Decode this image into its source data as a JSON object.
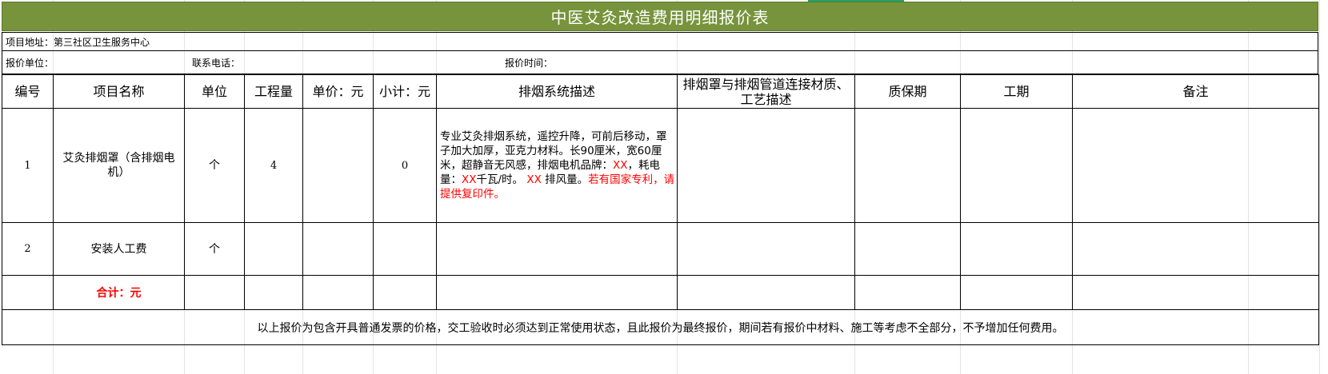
{
  "title": "中医艾灸改造费用明细报价表",
  "info": {
    "address_label": "项目地址：",
    "address_value": "第三社区卫生服务中心",
    "quote_unit_label": "报价单位：",
    "contact_label": "联系电话：",
    "quote_time_label": "报价时间："
  },
  "table": {
    "headers": {
      "no": "编号",
      "name": "项目名称",
      "unit": "单位",
      "qty": "工程量",
      "price": "单价：元",
      "subtotal": "小计：元",
      "system_desc": "排烟系统描述",
      "connect_desc": "排烟罩与排烟管道连接材质、工艺描述",
      "warranty": "质保期",
      "period": "工期",
      "remarks": "备注"
    },
    "rows": [
      {
        "no": "1",
        "name": "艾灸排烟罩（含排烟电机）",
        "unit": "个",
        "qty": "4",
        "price": "",
        "subtotal": "0",
        "desc_part1": "专业艾灸排烟系统，遥控升降，可前后移动，罩子加大加厚，亚克力材料。长90厘米，宽60厘米，超静音无风感，排烟电机品牌：",
        "desc_red1": "XX",
        "desc_part2": "，耗电量：",
        "desc_red2": "XX",
        "desc_part3": "千瓦/时。  ",
        "desc_red3": "XX",
        "desc_part4": " 排风量。",
        "desc_red4": "若有国家专利，请提供复印件。"
      },
      {
        "no": "2",
        "name": "安装人工费",
        "unit": "个",
        "qty": "",
        "price": "",
        "subtotal": ""
      }
    ],
    "total_label": "合计：元",
    "footnote": "以上报价为包含开具普通发票的价格，交工验收时必须达到正常使用状态，且此报价为最终报价，期间若有报价中材料、施工等考虑不全部分，不予增加任何费用。"
  }
}
